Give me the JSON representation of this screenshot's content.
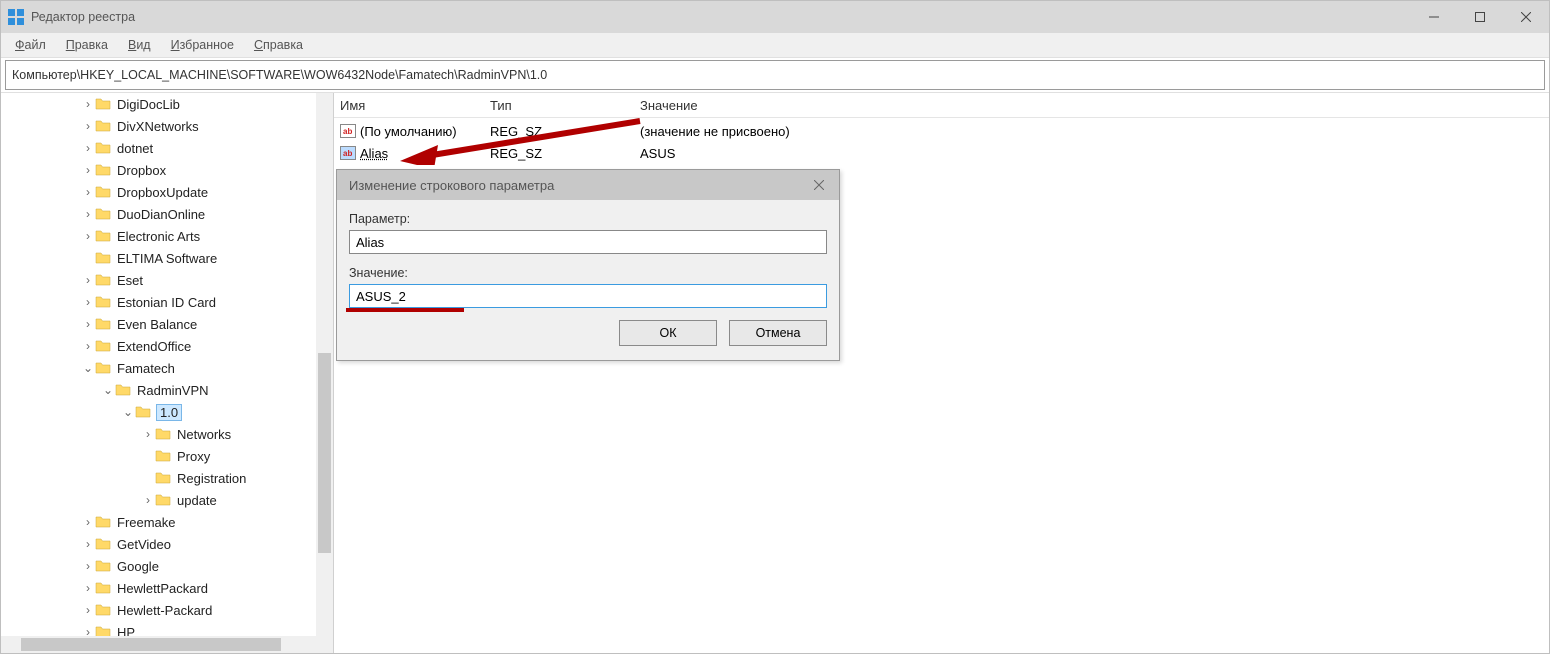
{
  "window": {
    "title": "Редактор реестра",
    "menu": [
      "Файл",
      "Правка",
      "Вид",
      "Избранное",
      "Справка"
    ],
    "address": "Компьютер\\HKEY_LOCAL_MACHINE\\SOFTWARE\\WOW6432Node\\Famatech\\RadminVPN\\1.0"
  },
  "tree": {
    "items": [
      {
        "depth": 4,
        "chev": ">",
        "label": "DigiDocLib"
      },
      {
        "depth": 4,
        "chev": ">",
        "label": "DivXNetworks"
      },
      {
        "depth": 4,
        "chev": ">",
        "label": "dotnet"
      },
      {
        "depth": 4,
        "chev": ">",
        "label": "Dropbox"
      },
      {
        "depth": 4,
        "chev": ">",
        "label": "DropboxUpdate"
      },
      {
        "depth": 4,
        "chev": ">",
        "label": "DuoDianOnline"
      },
      {
        "depth": 4,
        "chev": ">",
        "label": "Electronic Arts"
      },
      {
        "depth": 4,
        "chev": "",
        "label": "ELTIMA Software"
      },
      {
        "depth": 4,
        "chev": ">",
        "label": "Eset"
      },
      {
        "depth": 4,
        "chev": ">",
        "label": "Estonian ID Card"
      },
      {
        "depth": 4,
        "chev": ">",
        "label": "Even Balance"
      },
      {
        "depth": 4,
        "chev": ">",
        "label": "ExtendOffice"
      },
      {
        "depth": 4,
        "chev": "v",
        "label": "Famatech"
      },
      {
        "depth": 5,
        "chev": "v",
        "label": "RadminVPN"
      },
      {
        "depth": 6,
        "chev": "v",
        "label": "1.0",
        "selected": true
      },
      {
        "depth": 7,
        "chev": ">",
        "label": "Networks"
      },
      {
        "depth": 7,
        "chev": "",
        "label": "Proxy"
      },
      {
        "depth": 7,
        "chev": "",
        "label": "Registration"
      },
      {
        "depth": 7,
        "chev": ">",
        "label": "update"
      },
      {
        "depth": 4,
        "chev": ">",
        "label": "Freemake"
      },
      {
        "depth": 4,
        "chev": ">",
        "label": "GetVideo"
      },
      {
        "depth": 4,
        "chev": ">",
        "label": "Google"
      },
      {
        "depth": 4,
        "chev": ">",
        "label": "HewlettPackard"
      },
      {
        "depth": 4,
        "chev": ">",
        "label": "Hewlett-Packard"
      },
      {
        "depth": 4,
        "chev": ">",
        "label": "HP"
      }
    ]
  },
  "list": {
    "columns": {
      "name": "Имя",
      "type": "Тип",
      "value": "Значение"
    },
    "rows": [
      {
        "icon": "str",
        "name": "(По умолчанию)",
        "type": "REG_SZ",
        "value": "(значение не присвоено)"
      },
      {
        "icon": "str-sel",
        "name": "Alias",
        "type": "REG_SZ",
        "value": "ASUS",
        "selected": true
      }
    ]
  },
  "dialog": {
    "title": "Изменение строкового параметра",
    "param_label": "Параметр:",
    "param_value": "Alias",
    "value_label": "Значение:",
    "value_value": "ASUS_2",
    "ok": "ОК",
    "cancel": "Отмена"
  }
}
